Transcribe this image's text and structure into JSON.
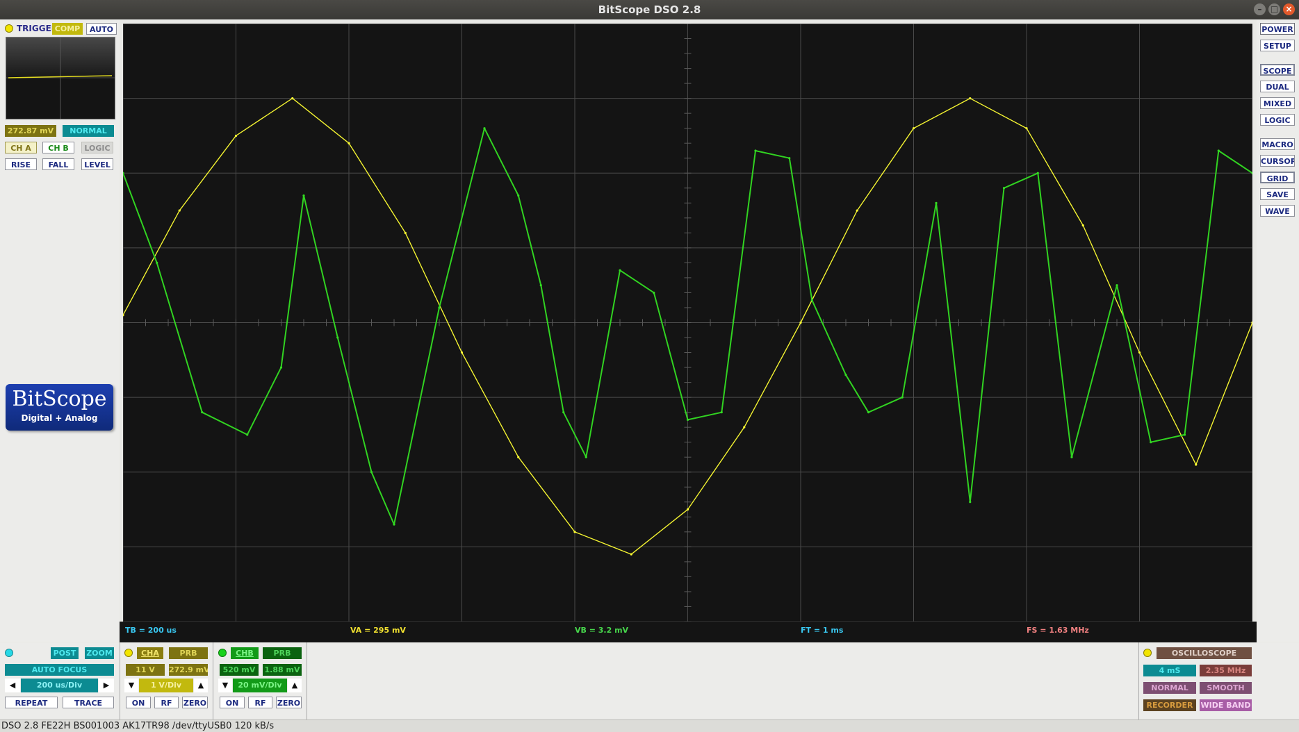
{
  "window": {
    "title": "BitScope DSO 2.8",
    "controls": [
      "–",
      "□",
      "×"
    ]
  },
  "trigger": {
    "label": "TRIGGER",
    "mode": "COMP",
    "auto": "AUTO",
    "level_value": "272.87 mV",
    "status": "NORMAL",
    "sources": [
      "CH A",
      "CH B",
      "LOGIC"
    ],
    "edges": [
      "RISE",
      "FALL",
      "LEVEL"
    ]
  },
  "logo": {
    "name": "BitScope",
    "tagline": "Digital + Analog"
  },
  "right_panel": {
    "group1": [
      "POWER",
      "SETUP"
    ],
    "group2": [
      "SCOPE",
      "DUAL",
      "MIXED",
      "LOGIC"
    ],
    "group3": [
      "MACRO",
      "CURSOR",
      "GRID",
      "SAVE",
      "WAVE"
    ]
  },
  "readout": {
    "tb": "TB = 200 us",
    "va": "VA = 295 mV",
    "vb": "VB = 3.2 mV",
    "ft": "FT = 1 ms",
    "fs": "FS = 1.63 MHz"
  },
  "timebase": {
    "post": "POST",
    "zoom": "ZOOM",
    "focus": "AUTO FOCUS",
    "div": "200 us/Div",
    "repeat": "REPEAT",
    "trace": "TRACE"
  },
  "channel_a": {
    "name": "CHA",
    "probe": "PRB",
    "range": "11 V",
    "offset": "272.9 mV",
    "div": "1 V/Div",
    "on": "ON",
    "rf": "RF",
    "zero": "ZERO"
  },
  "channel_b": {
    "name": "CHB",
    "probe": "PRB",
    "range": "520 mV",
    "offset": "1.88 mV",
    "div": "20 mV/Div",
    "on": "ON",
    "rf": "RF",
    "zero": "ZERO"
  },
  "display_panel": {
    "mode": "OSCILLOSCOPE",
    "duration": "4 mS",
    "rate": "2.35 MHz",
    "normal": "NORMAL",
    "smooth": "SMOOTH",
    "recorder": "RECORDER",
    "wideband": "WIDE BAND"
  },
  "status_bar": "DSO 2.8 FE22H BS001003 AK17TR98 /dev/ttyUSB0 120 kB/s",
  "colors": {
    "cha": "#ffff33",
    "chb": "#33dd22",
    "grid": "#4a4a4a",
    "screen": "#141414"
  },
  "chart_data": {
    "type": "line",
    "xlim": [
      -5,
      5
    ],
    "ylim": [
      -4,
      4
    ],
    "grid": "10 x 8 divisions",
    "series": [
      {
        "name": "CHA",
        "color": "#ffff33",
        "x": [
          -5,
          -4.5,
          -4,
          -3.5,
          -3,
          -2.5,
          -2,
          -1.5,
          -1,
          -0.5,
          0,
          0.5,
          1,
          1.5,
          2,
          2.5,
          3,
          3.5,
          4,
          4.5,
          5
        ],
        "y": [
          0.1,
          1.5,
          2.5,
          3.0,
          2.4,
          1.2,
          -0.4,
          -1.8,
          -2.8,
          -3.1,
          -2.5,
          -1.4,
          0.0,
          1.5,
          2.6,
          3.0,
          2.6,
          1.3,
          -0.4,
          -1.9,
          0.0
        ]
      },
      {
        "name": "CHB",
        "color": "#33dd22",
        "x": [
          -5,
          -4.7,
          -4.3,
          -3.9,
          -3.6,
          -3.4,
          -3.1,
          -2.8,
          -2.6,
          -2.2,
          -1.8,
          -1.5,
          -1.3,
          -1.1,
          -0.9,
          -0.6,
          -0.3,
          0,
          0.3,
          0.6,
          0.9,
          1.1,
          1.4,
          1.6,
          1.9,
          2.2,
          2.5,
          2.8,
          3.1,
          3.4,
          3.8,
          4.1,
          4.4,
          4.7,
          5
        ],
        "y": [
          2.0,
          0.8,
          -1.2,
          -1.5,
          -0.6,
          1.7,
          -0.2,
          -2.0,
          -2.7,
          0.2,
          2.6,
          1.7,
          0.5,
          -1.2,
          -1.8,
          0.7,
          0.4,
          -1.3,
          -1.2,
          2.3,
          2.2,
          0.3,
          -0.7,
          -1.2,
          -1.0,
          1.6,
          -2.4,
          1.8,
          2.0,
          -1.8,
          0.5,
          -1.6,
          -1.5,
          2.3,
          2.0
        ]
      }
    ]
  }
}
